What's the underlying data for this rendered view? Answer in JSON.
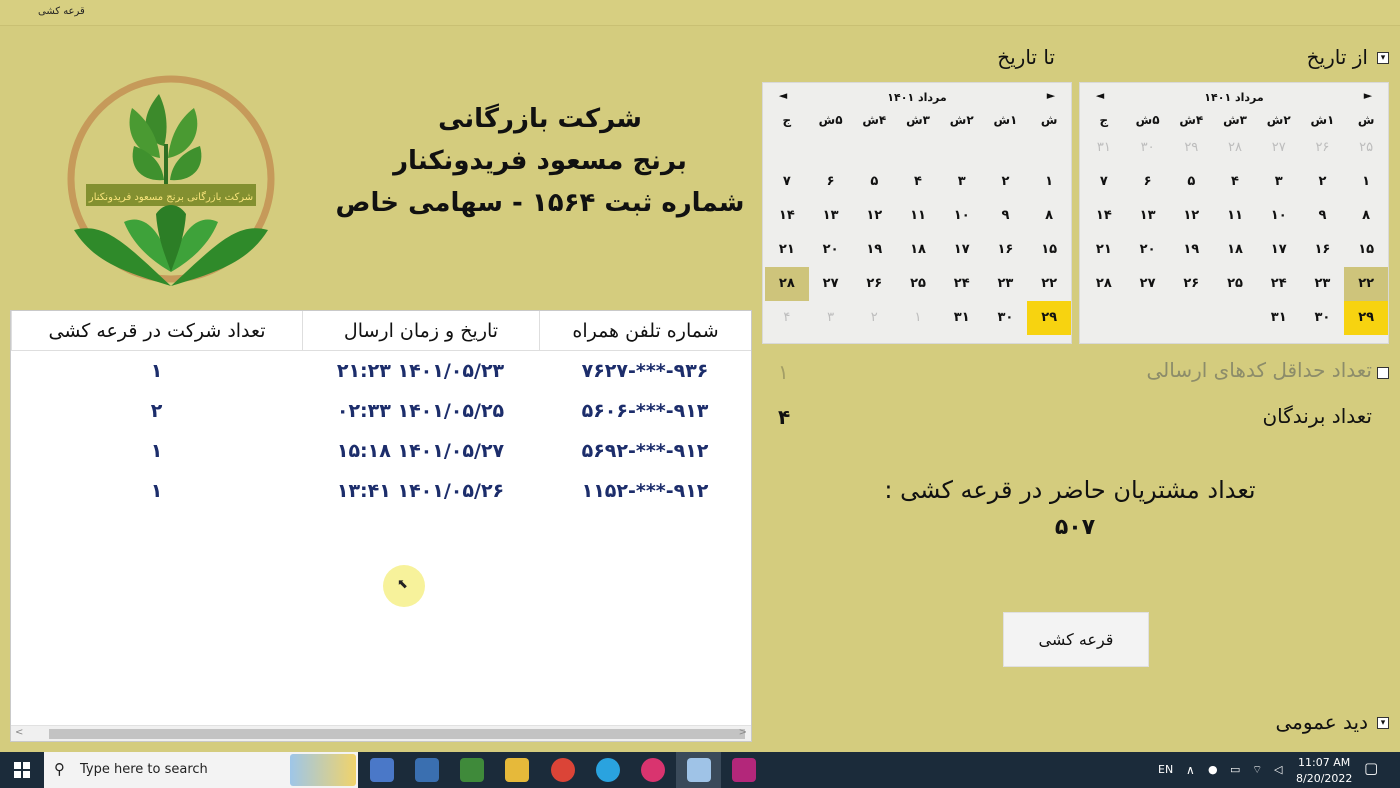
{
  "window": {
    "title": "قرعه کشی"
  },
  "company": {
    "line1": "شرکت بازرگانی",
    "line2": "برنج مسعود فریدونکنار",
    "line3": "شماره ثبت ۱۵۶۴ - سهامی خاص"
  },
  "logo": {
    "text": "شرکت بازرگانی برنج مسعود فریدونکنار"
  },
  "filters": {
    "from_label": "از تاریخ",
    "to_label": "تا تاریخ",
    "min_codes_label": "تعداد حداقل کدهای ارسالی",
    "min_codes_value": "۱",
    "winners_label": "تعداد برندگان",
    "winners_value": "۴",
    "participants_label": "تعداد مشتریان حاضر در قرعه کشی :",
    "participants_value": "۵۰۷",
    "general_view_label": "دید عمومی",
    "draw_button": "قرعه کشی"
  },
  "calendar_from": {
    "month": "مرداد ۱۴۰۱",
    "prev": "◄",
    "next": "►",
    "weekdays": [
      "ش",
      "۱ش",
      "۲ش",
      "۳ش",
      "۴ش",
      "۵ش",
      "ج"
    ],
    "days": [
      {
        "t": "۲۵",
        "k": "o"
      },
      {
        "t": "۲۶",
        "k": "o"
      },
      {
        "t": "۲۷",
        "k": "o"
      },
      {
        "t": "۲۸",
        "k": "o"
      },
      {
        "t": "۲۹",
        "k": "o"
      },
      {
        "t": "۳۰",
        "k": "o"
      },
      {
        "t": "۳۱",
        "k": "o"
      },
      {
        "t": "۱",
        "k": ""
      },
      {
        "t": "۲",
        "k": ""
      },
      {
        "t": "۳",
        "k": ""
      },
      {
        "t": "۴",
        "k": ""
      },
      {
        "t": "۵",
        "k": ""
      },
      {
        "t": "۶",
        "k": ""
      },
      {
        "t": "۷",
        "k": ""
      },
      {
        "t": "۸",
        "k": ""
      },
      {
        "t": "۹",
        "k": ""
      },
      {
        "t": "۱۰",
        "k": ""
      },
      {
        "t": "۱۱",
        "k": ""
      },
      {
        "t": "۱۲",
        "k": ""
      },
      {
        "t": "۱۳",
        "k": ""
      },
      {
        "t": "۱۴",
        "k": ""
      },
      {
        "t": "۱۵",
        "k": ""
      },
      {
        "t": "۱۶",
        "k": ""
      },
      {
        "t": "۱۷",
        "k": ""
      },
      {
        "t": "۱۸",
        "k": ""
      },
      {
        "t": "۱۹",
        "k": ""
      },
      {
        "t": "۲۰",
        "k": ""
      },
      {
        "t": "۲۱",
        "k": ""
      },
      {
        "t": "۲۲",
        "k": "sel"
      },
      {
        "t": "۲۳",
        "k": ""
      },
      {
        "t": "۲۴",
        "k": ""
      },
      {
        "t": "۲۵",
        "k": ""
      },
      {
        "t": "۲۶",
        "k": ""
      },
      {
        "t": "۲۷",
        "k": ""
      },
      {
        "t": "۲۸",
        "k": ""
      },
      {
        "t": "۲۹",
        "k": "today"
      },
      {
        "t": "۳۰",
        "k": ""
      },
      {
        "t": "۳۱",
        "k": ""
      },
      {
        "t": "",
        "k": "o"
      },
      {
        "t": "",
        "k": "o"
      },
      {
        "t": "",
        "k": "o"
      },
      {
        "t": "",
        "k": "o"
      }
    ]
  },
  "calendar_to": {
    "month": "مرداد ۱۴۰۱",
    "prev": "◄",
    "next": "►",
    "weekdays": [
      "ش",
      "۱ش",
      "۲ش",
      "۳ش",
      "۴ش",
      "۵ش",
      "ج"
    ],
    "days": [
      {
        "t": "",
        "k": "o"
      },
      {
        "t": "",
        "k": "o"
      },
      {
        "t": "",
        "k": "o"
      },
      {
        "t": "",
        "k": "o"
      },
      {
        "t": "",
        "k": "o"
      },
      {
        "t": "",
        "k": "o"
      },
      {
        "t": "",
        "k": "o"
      },
      {
        "t": "۱",
        "k": ""
      },
      {
        "t": "۲",
        "k": ""
      },
      {
        "t": "۳",
        "k": ""
      },
      {
        "t": "۴",
        "k": ""
      },
      {
        "t": "۵",
        "k": ""
      },
      {
        "t": "۶",
        "k": ""
      },
      {
        "t": "۷",
        "k": ""
      },
      {
        "t": "۸",
        "k": ""
      },
      {
        "t": "۹",
        "k": ""
      },
      {
        "t": "۱۰",
        "k": ""
      },
      {
        "t": "۱۱",
        "k": ""
      },
      {
        "t": "۱۲",
        "k": ""
      },
      {
        "t": "۱۳",
        "k": ""
      },
      {
        "t": "۱۴",
        "k": ""
      },
      {
        "t": "۱۵",
        "k": ""
      },
      {
        "t": "۱۶",
        "k": ""
      },
      {
        "t": "۱۷",
        "k": ""
      },
      {
        "t": "۱۸",
        "k": ""
      },
      {
        "t": "۱۹",
        "k": ""
      },
      {
        "t": "۲۰",
        "k": ""
      },
      {
        "t": "۲۱",
        "k": ""
      },
      {
        "t": "۲۲",
        "k": ""
      },
      {
        "t": "۲۳",
        "k": ""
      },
      {
        "t": "۲۴",
        "k": ""
      },
      {
        "t": "۲۵",
        "k": ""
      },
      {
        "t": "۲۶",
        "k": ""
      },
      {
        "t": "۲۷",
        "k": ""
      },
      {
        "t": "۲۸",
        "k": "sel"
      },
      {
        "t": "۲۹",
        "k": "today"
      },
      {
        "t": "۳۰",
        "k": ""
      },
      {
        "t": "۳۱",
        "k": ""
      },
      {
        "t": "۱",
        "k": "o"
      },
      {
        "t": "۲",
        "k": "o"
      },
      {
        "t": "۳",
        "k": "o"
      },
      {
        "t": "۴",
        "k": "o"
      }
    ]
  },
  "table": {
    "headers": {
      "phone": "شماره تلفن همراه",
      "datetime": "تاریخ و زمان ارسال",
      "count": "تعداد شرکت در قرعه کشی"
    },
    "rows": [
      {
        "phone": "۹۳۶-***-۷۶۲۷",
        "datetime": "۱۴۰۱/۰۵/۲۳ ۲۱:۲۳",
        "count": "۱"
      },
      {
        "phone": "۹۱۳-***-۵۶۰۶",
        "datetime": "۱۴۰۱/۰۵/۲۵ ۰۲:۳۳",
        "count": "۲"
      },
      {
        "phone": "۹۱۲-***-۵۶۹۲",
        "datetime": "۱۴۰۱/۰۵/۲۷ ۱۵:۱۸",
        "count": "۱"
      },
      {
        "phone": "۹۱۲-***-۱۱۵۲",
        "datetime": "۱۴۰۱/۰۵/۲۶ ۱۳:۴۱",
        "count": "۱"
      }
    ]
  },
  "taskbar": {
    "search_placeholder": "Type here to search",
    "lang": "EN",
    "time": "11:07 AM",
    "date": "8/20/2022"
  }
}
